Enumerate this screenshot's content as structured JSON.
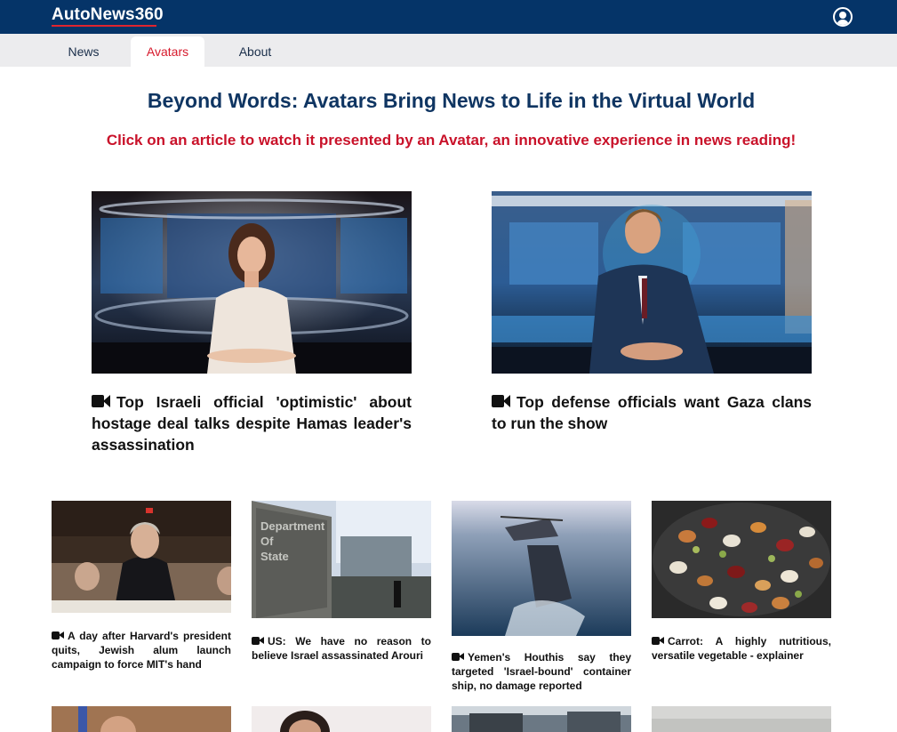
{
  "header": {
    "logo": "AutoNews360",
    "colors": {
      "bar": "#053468",
      "accent": "#e0242f"
    },
    "user_icon": "account-circle-icon"
  },
  "nav": {
    "tabs": [
      {
        "label": "News",
        "active": false
      },
      {
        "label": "Avatars",
        "active": true
      },
      {
        "label": "About",
        "active": false
      }
    ]
  },
  "main": {
    "headline": "Beyond Words: Avatars Bring News to Life in the Virtual World",
    "subheadline": "Click on an article to watch it presented by an Avatar, an innovative experience in news reading!",
    "featured": [
      {
        "icon": "video-camera-icon",
        "title": "Top Israeli official 'optimistic' about hostage deal talks despite Hamas leader's assassination",
        "image": "female news anchor in studio"
      },
      {
        "icon": "video-camera-icon",
        "title": "Top defense officials want Gaza clans to run the show",
        "image": "male news anchor in studio"
      }
    ],
    "articles": [
      {
        "icon": "video-camera-icon",
        "title": "A day after Harvard's president quits, Jewish alum launch campaign to force MIT's hand",
        "image": "hearing room photo"
      },
      {
        "icon": "video-camera-icon",
        "title": "US: We have no reason to believe Israel assassinated Arouri",
        "image": "Department of State sign"
      },
      {
        "icon": "video-camera-icon",
        "title": "Yemen's Houthis say they targeted 'Israel-bound' container ship, no damage reported",
        "image": "helicopter over ship at sea"
      },
      {
        "icon": "video-camera-icon",
        "title": "Carrot: A highly nutritious, versatile vegetable - explainer",
        "image": "bowl of mixed beans"
      }
    ],
    "more_articles_count": 4
  }
}
